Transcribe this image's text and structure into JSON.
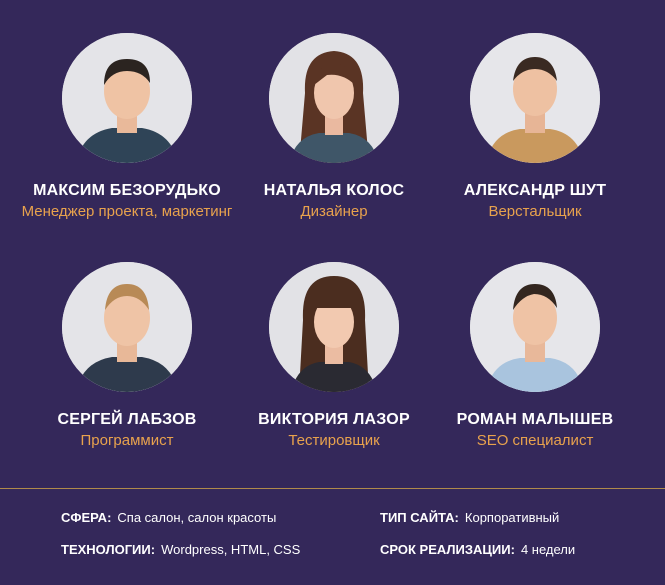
{
  "team": [
    {
      "name": "МАКСИМ БЕЗОРУДЬКО",
      "role": "Менеджер проекта, маркетинг"
    },
    {
      "name": "НАТАЛЬЯ КОЛОС",
      "role": "Дизайнер"
    },
    {
      "name": "АЛЕКСАНДР ШУТ",
      "role": "Верстальщик"
    },
    {
      "name": "СЕРГЕЙ ЛАБЗОВ",
      "role": "Программист"
    },
    {
      "name": "ВИКТОРИЯ ЛАЗОР",
      "role": "Тестировщик"
    },
    {
      "name": "РОМАН МАЛЫШЕВ",
      "role": "SEO специалист"
    }
  ],
  "details": {
    "sphere_label": "СФЕРА:",
    "sphere_value": "Спа салон, салон красоты",
    "site_type_label": "ТИП САЙТА:",
    "site_type_value": "Корпоративный",
    "tech_label": "ТЕХНОЛОГИИ:",
    "tech_value": "Wordpress, HTML, CSS",
    "term_label": "СРОК РЕАЛИЗАЦИИ:",
    "term_value": "4 недели"
  },
  "colors": {
    "background": "#34285a",
    "accent": "#e8a24d",
    "divider": "#b08a4a"
  }
}
